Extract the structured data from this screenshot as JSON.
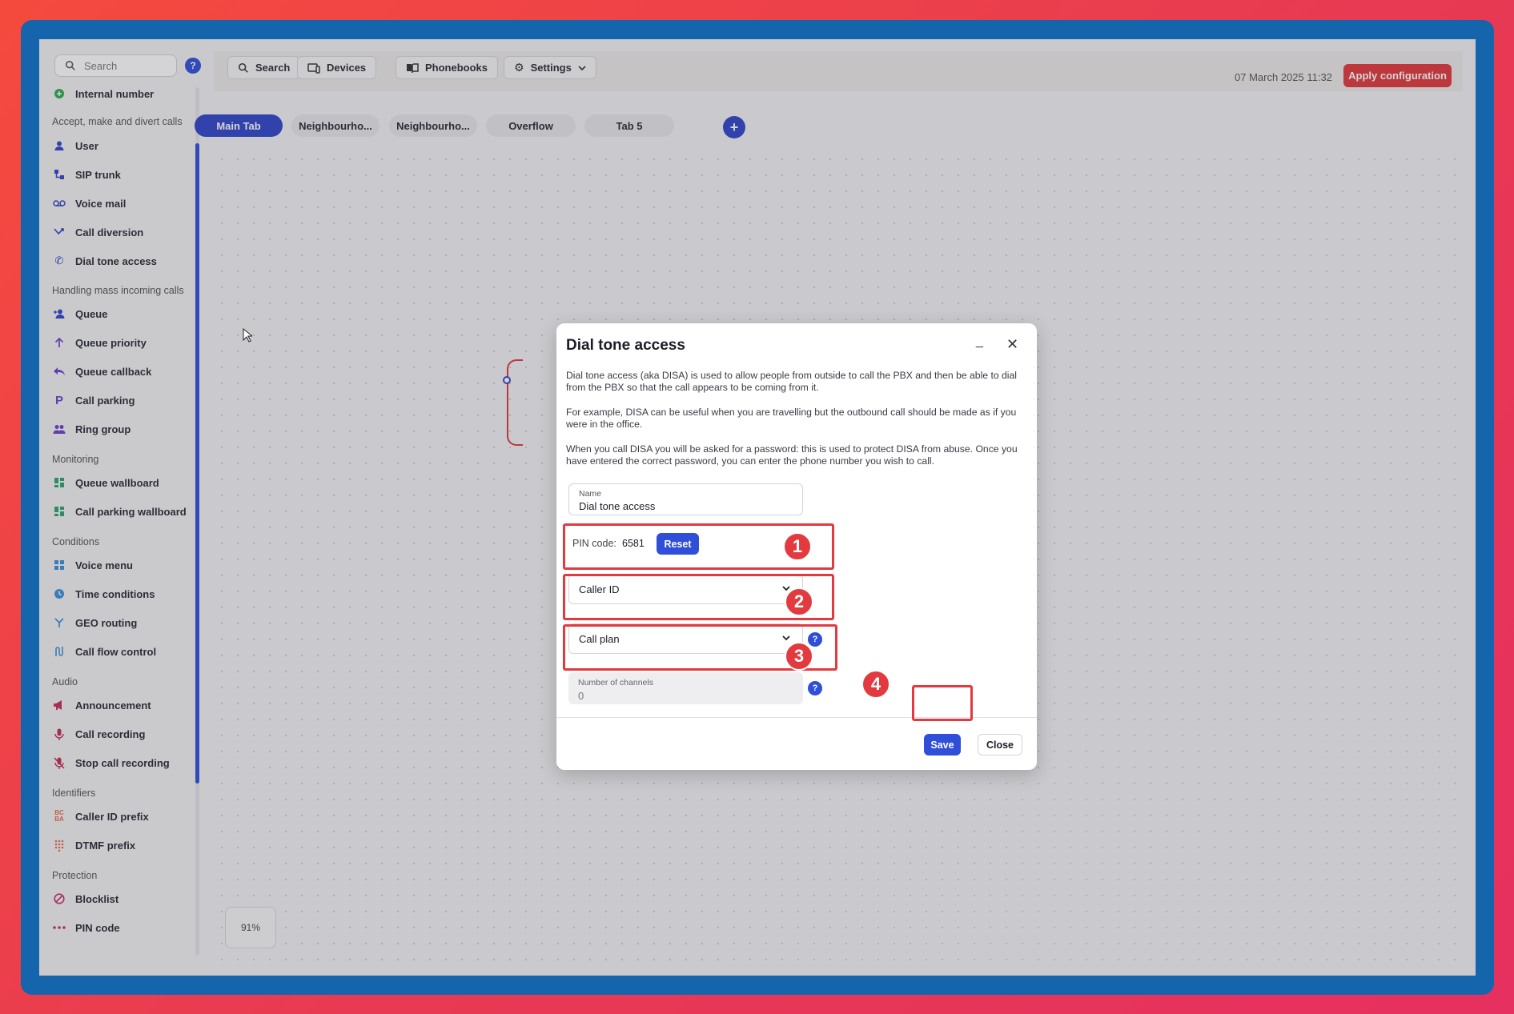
{
  "sidebar": {
    "search_placeholder": "Search",
    "help": "?",
    "items": [
      {
        "label": "Internal number"
      },
      {
        "section": "Accept, make and divert calls"
      },
      {
        "label": "User"
      },
      {
        "label": "SIP trunk"
      },
      {
        "label": "Voice mail"
      },
      {
        "label": "Call diversion"
      },
      {
        "label": "Dial tone access"
      },
      {
        "section": "Handling mass incoming calls"
      },
      {
        "label": "Queue"
      },
      {
        "label": "Queue priority"
      },
      {
        "label": "Queue callback"
      },
      {
        "label": "Call parking"
      },
      {
        "label": "Ring group"
      },
      {
        "section": "Monitoring"
      },
      {
        "label": "Queue wallboard"
      },
      {
        "label": "Call parking wallboard"
      },
      {
        "section": "Conditions"
      },
      {
        "label": "Voice menu"
      },
      {
        "label": "Time conditions"
      },
      {
        "label": "GEO routing"
      },
      {
        "label": "Call flow control"
      },
      {
        "section": "Audio"
      },
      {
        "label": "Announcement"
      },
      {
        "label": "Call recording"
      },
      {
        "label": "Stop call recording"
      },
      {
        "section": "Identifiers"
      },
      {
        "label": "Caller ID prefix"
      },
      {
        "label": "DTMF prefix"
      },
      {
        "section": "Protection"
      },
      {
        "label": "Blocklist"
      },
      {
        "label": "PIN code"
      }
    ]
  },
  "toolbar": {
    "search": "Search",
    "devices": "Devices",
    "phonebooks": "Phonebooks",
    "settings": "Settings",
    "date": "07 March 2025 11:32",
    "apply": "Apply configuration"
  },
  "tabs": [
    {
      "label": "Main Tab",
      "active": true
    },
    {
      "label": "Neighbourho..."
    },
    {
      "label": "Neighbourho..."
    },
    {
      "label": "Overflow"
    },
    {
      "label": "Tab 5"
    }
  ],
  "zoom": "91%",
  "modal": {
    "title": "Dial tone access",
    "minimize": "_",
    "close": "✕",
    "p1": "Dial tone access (aka DISA) is used to allow people from outside to call the PBX and then be able to dial from the PBX so that the call appears to be coming from it.",
    "p2": "For example, DISA can be useful when you are travelling but the outbound call should be made as if you were in the office.",
    "p3": "When you call DISA you will be asked for a password: this is used to protect DISA from abuse. Once you have entered the correct password, you can enter the phone number you wish to call.",
    "name_label": "Name",
    "name_value": "Dial tone access",
    "pin_label": "PIN code:",
    "pin_value": "6581",
    "reset": "Reset",
    "caller_id": "Caller ID",
    "call_plan": "Call plan",
    "channels_label": "Number of channels",
    "channels_value": "0",
    "help": "?",
    "save": "Save",
    "close_btn": "Close"
  },
  "annotations": [
    "1",
    "2",
    "3",
    "4"
  ],
  "colors": {
    "accent": "#2f4fd8",
    "danger": "#e1383c",
    "highlight": "#e33a3f"
  }
}
